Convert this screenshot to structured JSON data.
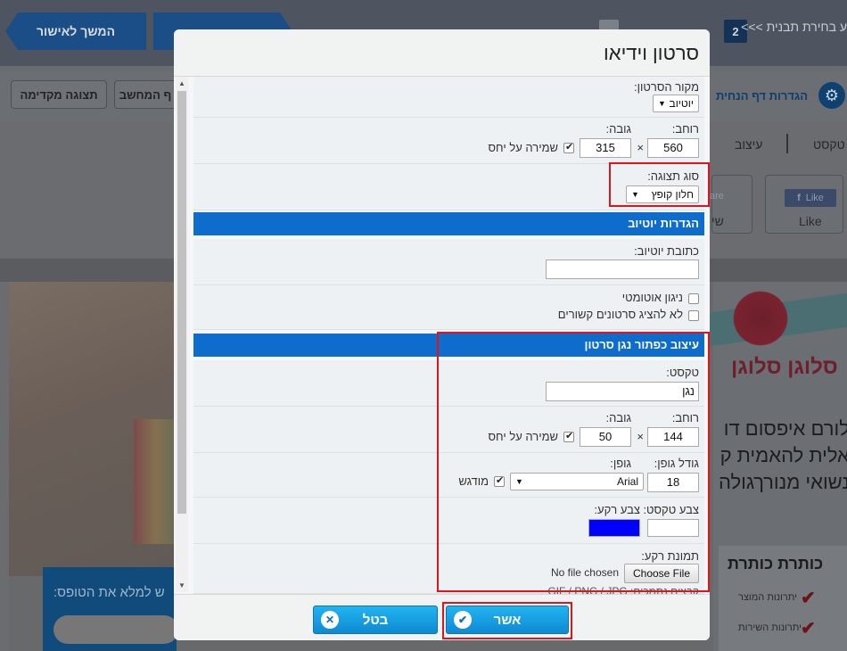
{
  "background": {
    "continue_button": "המשך לאישור",
    "step_text": "ע בחירת תבנית >>>",
    "step_number": "2",
    "preview_button": "תצוגה מקדימה",
    "computer_button": "ף המחשב",
    "settings_title": "הגדרות דף הנחית",
    "tab_text": "טקסט",
    "tab_design": "עיצוב",
    "like_badge": "Like",
    "like_label": "Like",
    "share_partial": "שי",
    "share_badge": "are",
    "signup_text": "ש למלא את הטופס:",
    "slogan": "סלוגן סלוגן",
    "lorem_lines": [
      "לורם איפסום דו",
      "אלית להאמית ק",
      "נשואי מנורךגולה"
    ],
    "features_title": "כותרת כותרת",
    "feature_1": "יתרונות המוצר",
    "feature_2": "יתרונות השירות"
  },
  "modal": {
    "title": "סרטון וידיאו",
    "video_source_label": "מקור הסרטון:",
    "video_source_value": "יוטיוב",
    "width_label": "רוחב:",
    "height_label": "גובה:",
    "width_value": "560",
    "height_value": "315",
    "times": "×",
    "keep_ratio_label": "שמירה על יחס",
    "display_type_label": "סוג תצוגה:",
    "display_type_value": "חלון קופץ",
    "youtube_section": "הגדרות יוטיוב",
    "youtube_address_label": "כתובת יוטיוב:",
    "youtube_address_value": "",
    "autoplay_label": "ניגון אוטומטי",
    "hide_related_label": "לא להציג סרטונים קשורים",
    "button_section": "עיצוב כפתור נגן סרטון",
    "text_label": "טקסט:",
    "text_value": "נגן",
    "btn_width_label": "רוחב:",
    "btn_height_label": "גובה:",
    "btn_width_value": "144",
    "btn_height_value": "50",
    "btn_keep_ratio_label": "שמירה על יחס",
    "font_size_label": "גודל גופן:",
    "font_label": "גופן:",
    "font_size_value": "18",
    "font_value": "Arial",
    "bold_label": "מודגש",
    "text_color_label": "צבע טקסט:",
    "bg_color_label": "צבע רקע:",
    "text_color": "#ffffff",
    "bg_color": "#0000ff",
    "bg_image_label": "תמונת רקע:",
    "choose_file": "Choose File",
    "no_file": "No file chosen",
    "supported_files": "קבצים נתמכים: GIF / PNG / JPG",
    "ok_label": "אשר",
    "cancel_label": "בטל"
  }
}
